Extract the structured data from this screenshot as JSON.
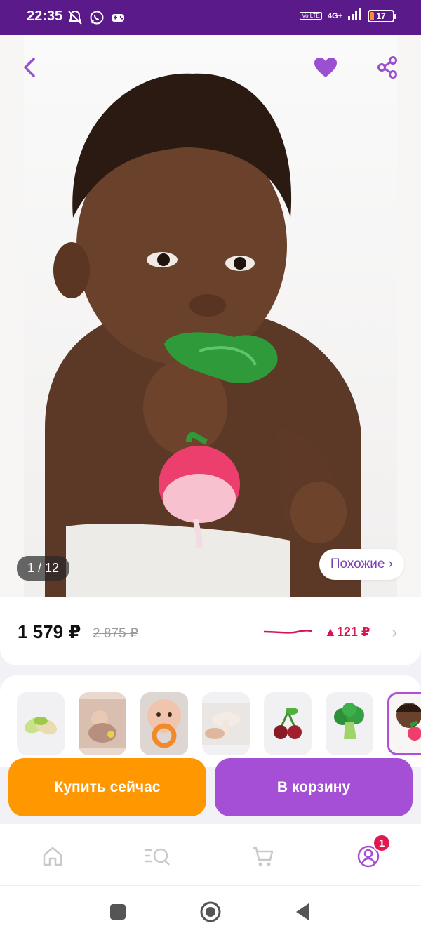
{
  "status_bar": {
    "time": "22:35",
    "network": "4G+",
    "volte": "Vo LTE",
    "battery": "17",
    "battery_level": 0.17,
    "left_icons": [
      "mute-bell-icon",
      "whatsapp-icon",
      "gamepad-icon"
    ]
  },
  "product": {
    "pager": "1 / 12",
    "similar_label": "Похожие ›",
    "price": "1 579 ₽",
    "old_price": "2 875 ₽",
    "price_change": "▲121 ₽"
  },
  "variants": [
    {
      "name": "pistachio-toy"
    },
    {
      "name": "baby-on-blanket"
    },
    {
      "name": "baby-with-orange-toy"
    },
    {
      "name": "mushroom-toy"
    },
    {
      "name": "cherry-toy"
    },
    {
      "name": "broccoli-toy"
    },
    {
      "name": "radish-toy",
      "selected": true
    }
  ],
  "actions": {
    "buy_now": "Купить сейчас",
    "add_to_cart": "В корзину"
  },
  "bottom_nav": {
    "items": [
      "home-icon",
      "catalog-search-icon",
      "cart-icon",
      "profile-icon"
    ],
    "profile_badge": "1"
  },
  "colors": {
    "status_bar": "#5a1a8a",
    "accent": "#a44fd6",
    "buy": "#ff9800",
    "price_change": "#d6174f"
  }
}
